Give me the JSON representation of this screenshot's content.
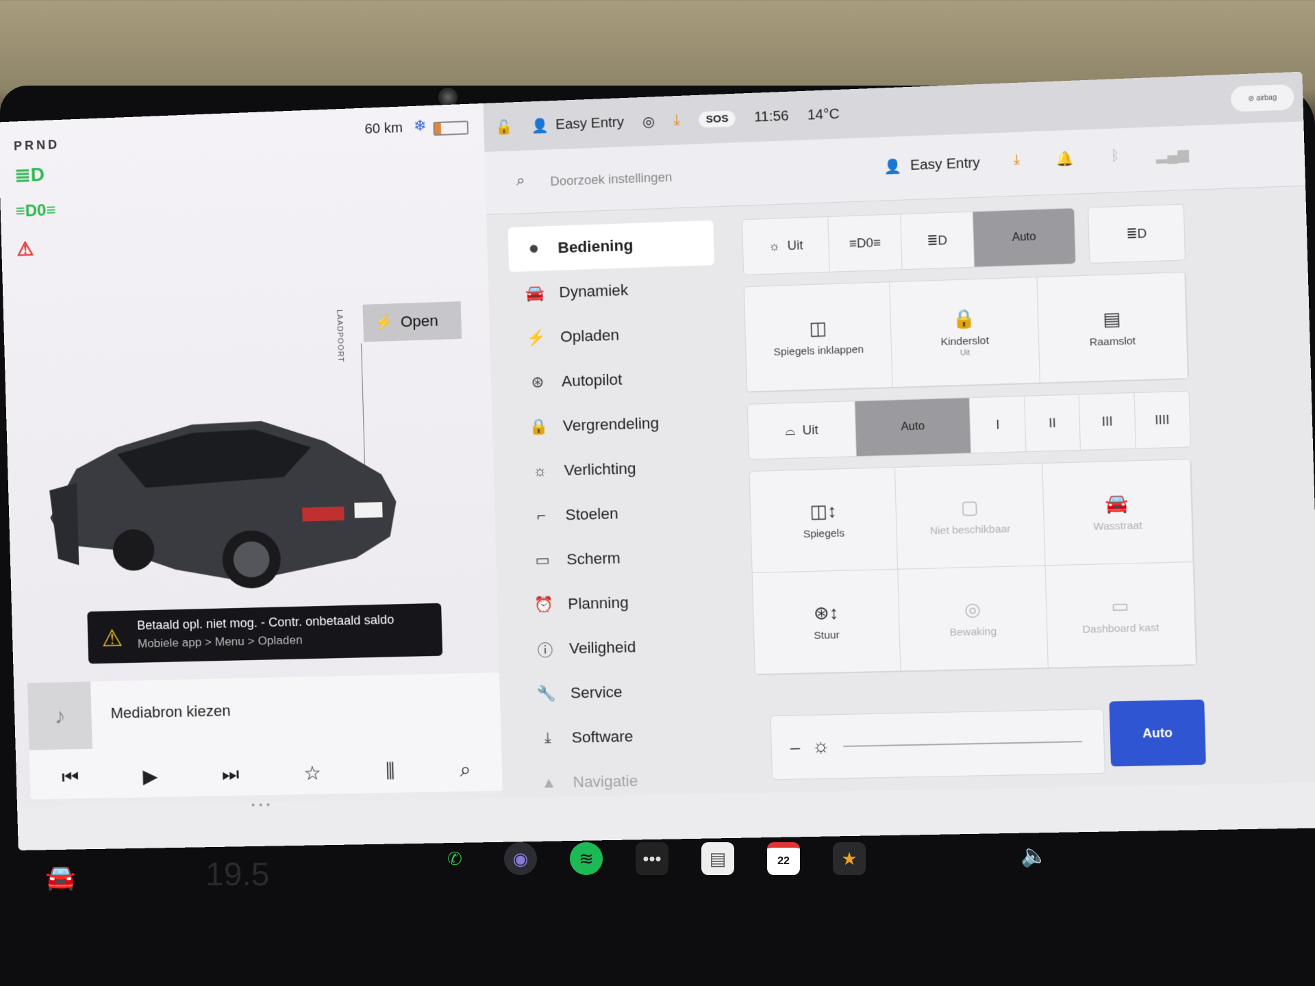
{
  "status": {
    "gear": "PRND",
    "range": "60 km",
    "time": "11:56",
    "temperature": "14°C",
    "sos": "SOS",
    "profile": "Easy Entry"
  },
  "charge_port": {
    "label": "LAADPOORT",
    "button": "Open"
  },
  "alert": {
    "title": "Betaald opl. niet mog. - Contr. onbetaald saldo",
    "subtitle": "Mobiele app > Menu > Opladen"
  },
  "media": {
    "title": "Mediabron kiezen"
  },
  "settings": {
    "search_placeholder": "Doorzoek instellingen",
    "profile": "Easy Entry",
    "menu": [
      {
        "label": "Bediening",
        "icon": "toggle-icon"
      },
      {
        "label": "Dynamiek",
        "icon": "car-icon"
      },
      {
        "label": "Opladen",
        "icon": "bolt-icon"
      },
      {
        "label": "Autopilot",
        "icon": "steering-wheel-icon"
      },
      {
        "label": "Vergrendeling",
        "icon": "lock-icon"
      },
      {
        "label": "Verlichting",
        "icon": "sun-icon"
      },
      {
        "label": "Stoelen",
        "icon": "seat-icon"
      },
      {
        "label": "Scherm",
        "icon": "display-icon"
      },
      {
        "label": "Planning",
        "icon": "alarm-clock-icon"
      },
      {
        "label": "Veiligheid",
        "icon": "info-icon"
      },
      {
        "label": "Service",
        "icon": "wrench-icon"
      },
      {
        "label": "Software",
        "icon": "download-icon"
      },
      {
        "label": "Navigatie",
        "icon": "navigation-icon"
      }
    ],
    "lights": {
      "off": "Uit",
      "auto": "Auto"
    },
    "tiles1": [
      {
        "label": "Spiegels inklappen",
        "sub": ""
      },
      {
        "label": "Kinderslot",
        "sub": "Uit"
      },
      {
        "label": "Raamslot",
        "sub": ""
      }
    ],
    "wipers": {
      "off": "Uit",
      "auto": "Auto",
      "levels": [
        "I",
        "II",
        "III",
        "IIII"
      ]
    },
    "tiles2": [
      {
        "label": "Spiegels"
      },
      {
        "label": "Niet beschikbaar"
      },
      {
        "label": "Wasstraat"
      },
      {
        "label": "Stuur"
      },
      {
        "label": "Bewaking"
      },
      {
        "label": "Dashboard kast"
      }
    ],
    "brightness_auto": "Auto"
  },
  "taskbar": {
    "temp": "19.5",
    "calendar_day": "22"
  },
  "colors": {
    "accent": "#2f55d3",
    "green_indicator": "#2db84e",
    "red_indicator": "#e03434",
    "download": "#e8891e"
  }
}
